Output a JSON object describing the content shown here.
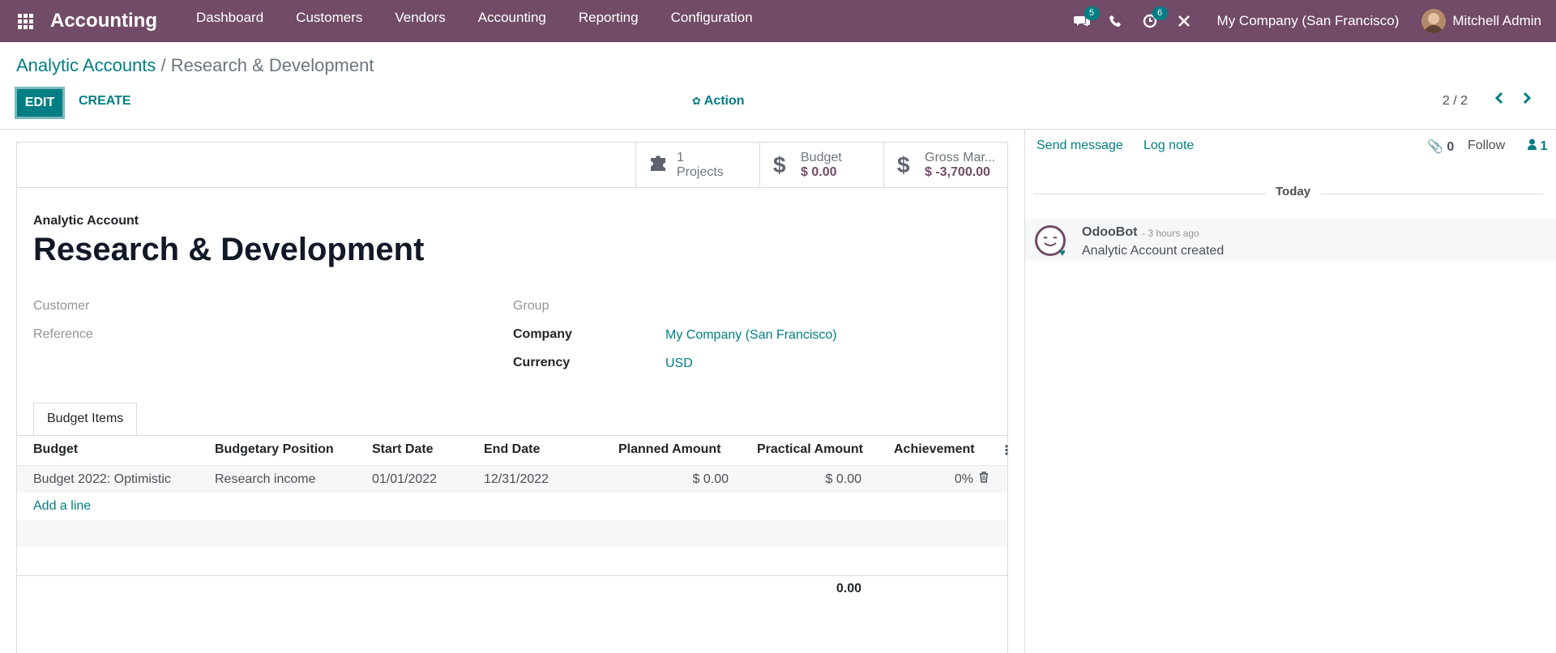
{
  "navbar": {
    "brand": "Accounting",
    "menu": [
      "Dashboard",
      "Customers",
      "Vendors",
      "Accounting",
      "Reporting",
      "Configuration"
    ],
    "messages_badge": "5",
    "activities_badge": "6",
    "company": "My Company (San Francisco)",
    "user": "Mitchell Admin"
  },
  "breadcrumb": {
    "parent": "Analytic Accounts",
    "separator": " / ",
    "current": "Research & Development"
  },
  "toolbar": {
    "edit_label": "EDIT",
    "create_label": "CREATE",
    "action_label": "Action",
    "pager": "2 / 2"
  },
  "stats": {
    "projects_count": "1",
    "projects_label": "Projects",
    "budget_label": "Budget",
    "budget_value": "$ 0.00",
    "gross_label": "Gross Mar...",
    "gross_value": "$ -3,700.00"
  },
  "form": {
    "subtitle": "Analytic Account",
    "title": "Research & Development",
    "customer_label": "Customer",
    "reference_label": "Reference",
    "group_label": "Group",
    "company_label": "Company",
    "company_value": "My Company (San Francisco)",
    "currency_label": "Currency",
    "currency_value": "USD"
  },
  "budget_tab": {
    "tab_label": "Budget Items",
    "columns": [
      "Budget",
      "Budgetary Position",
      "Start Date",
      "End Date",
      "Planned Amount",
      "Practical Amount",
      "Achievement"
    ],
    "rows": [
      {
        "budget": "Budget 2022: Optimistic",
        "position": "Research income",
        "start": "01/01/2022",
        "end": "12/31/2022",
        "planned": "$ 0.00",
        "practical": "$ 0.00",
        "achievement": "0%"
      }
    ],
    "add_line": "Add a line",
    "total": "0.00"
  },
  "chatter": {
    "send_message": "Send message",
    "log_note": "Log note",
    "attachments": "0",
    "follow": "Follow",
    "followers": "1",
    "date_separator": "Today",
    "messages": [
      {
        "author": "OdooBot",
        "time": "- 3 hours ago",
        "body": "Analytic Account created"
      }
    ]
  }
}
